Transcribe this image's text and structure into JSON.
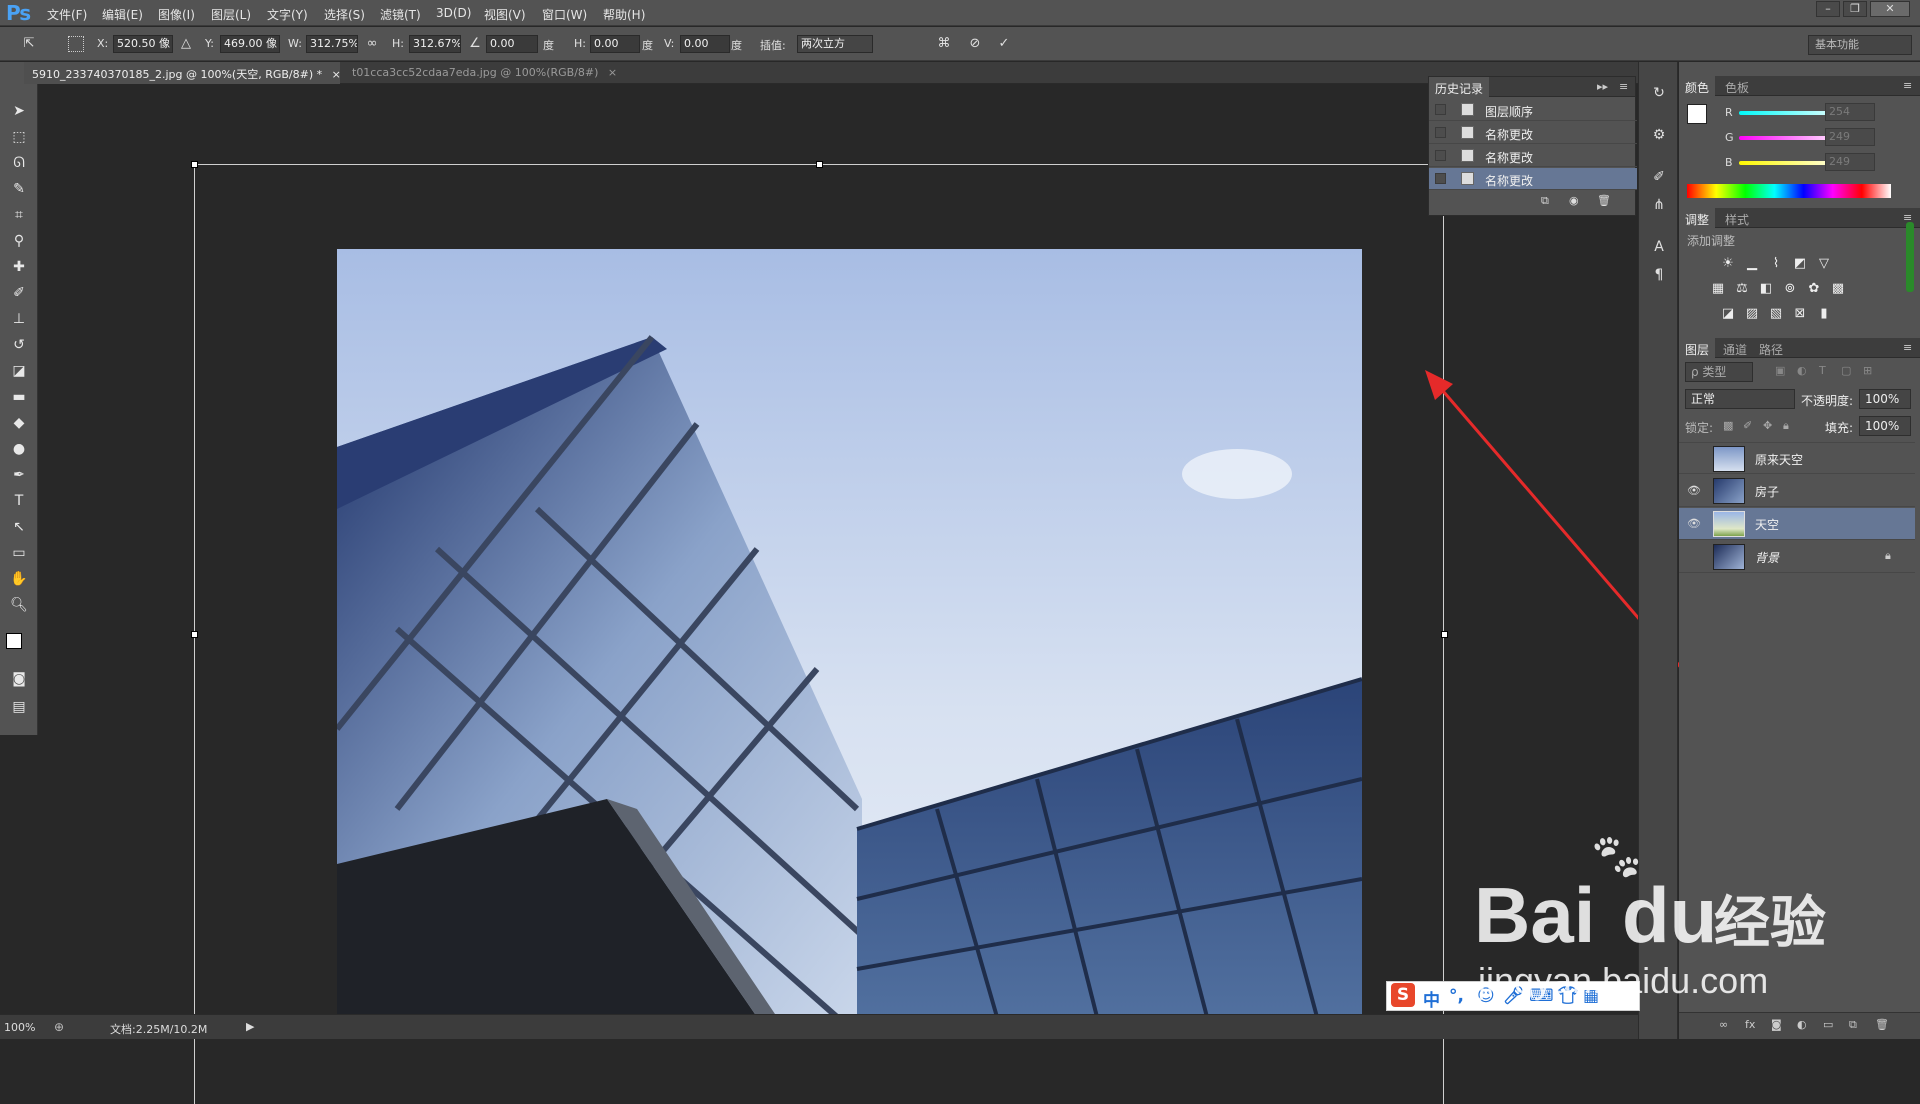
{
  "app": {
    "logo": "Ps",
    "colors": {
      "accent": "#4aa2f5",
      "panel": "#535353",
      "canvas": "#282828",
      "arrow": "#e52a2a"
    }
  },
  "menu": [
    "文件(F)",
    "编辑(E)",
    "图像(I)",
    "图层(L)",
    "文字(Y)",
    "选择(S)",
    "滤镜(T)",
    "3D(D)",
    "视图(V)",
    "窗口(W)",
    "帮助(H)"
  ],
  "window_controls": {
    "minimize": "–",
    "restore": "❐",
    "close": "✕"
  },
  "options": {
    "x_label": "X:",
    "x_value": "520.50 像",
    "y_label": "Y:",
    "y_value": "469.00 像",
    "w_label": "W:",
    "w_value": "312.75%",
    "h_label": "H:",
    "h_value": "312.67%",
    "angle_value": "0.00",
    "angle_unit": "度",
    "hskew_label": "H:",
    "hskew_value": "0.00",
    "hskew_unit": "度",
    "vskew_label": "V:",
    "vskew_value": "0.00",
    "vskew_unit": "度",
    "interp_label": "插值:",
    "interp_value": "两次立方",
    "workspace": "基本功能"
  },
  "tabs": [
    {
      "label": "5910_233740370185_2.jpg @ 100%(天空, RGB/8#) *",
      "close": "×"
    },
    {
      "label": "t01cca3cc52cdaa7eda.jpg @ 100%(RGB/8#)",
      "close": "×"
    }
  ],
  "history": {
    "title": "历史记录",
    "items": [
      "图层顺序",
      "名称更改",
      "名称更改",
      "名称更改"
    ]
  },
  "color_panel": {
    "tabs": [
      "颜色",
      "色板"
    ],
    "channels": [
      {
        "label": "R",
        "value": "254"
      },
      {
        "label": "G",
        "value": "249"
      },
      {
        "label": "B",
        "value": "249"
      }
    ]
  },
  "adjust_panel": {
    "tabs": [
      "调整",
      "样式"
    ],
    "add_label": "添加调整"
  },
  "layers_panel": {
    "tabs": [
      "图层",
      "通道",
      "路径"
    ],
    "filter_label": "ρ 类型",
    "blend_mode": "正常",
    "opacity_label": "不透明度:",
    "opacity_value": "100%",
    "lock_label": "锁定:",
    "fill_label": "填充:",
    "fill_value": "100%",
    "layers": [
      {
        "name": "原来天空",
        "visible": false
      },
      {
        "name": "房子",
        "visible": true
      },
      {
        "name": "天空",
        "visible": true,
        "selected": true
      },
      {
        "name": "背景",
        "visible": false,
        "locked": true
      }
    ]
  },
  "status": {
    "zoom": "100%",
    "doc_info": "文档:2.25M/10.2M"
  },
  "ime": {
    "lang": "中",
    "punct": "°,"
  },
  "watermark": {
    "brand": "Bai",
    "brand2": "du",
    "suffix": "经验",
    "url": "jingyan.baidu.com"
  }
}
